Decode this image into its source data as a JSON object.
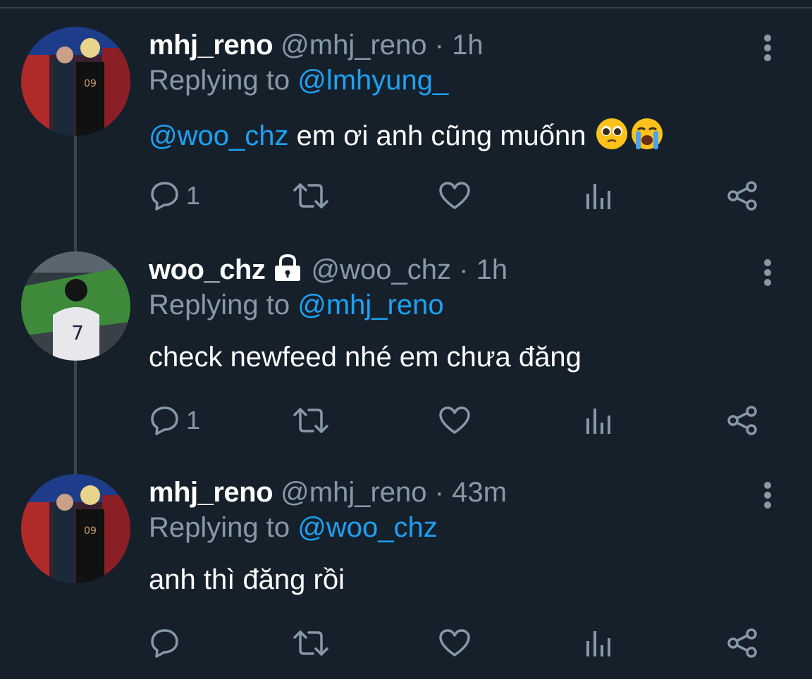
{
  "tweets": [
    {
      "display_name": "mhj_reno",
      "handle": "@mhj_reno",
      "time": "1h",
      "replying_label": "Replying to ",
      "replying_to": "@lmhyung_",
      "mention": "@woo_chz",
      "text": " em ơi anh cũng muốnn",
      "emojis": [
        "pleading-face",
        "loudly-crying-face"
      ],
      "reply_count": "1",
      "locked": false
    },
    {
      "display_name": "woo_chz",
      "handle": "@woo_chz",
      "time": "1h",
      "replying_label": "Replying to ",
      "replying_to": "@mhj_reno",
      "text": "check newfeed nhé em chưa đăng",
      "reply_count": "1",
      "locked": true
    },
    {
      "display_name": "mhj_reno",
      "handle": "@mhj_reno",
      "time": "43m",
      "replying_label": "Replying to ",
      "replying_to": "@woo_chz",
      "text": "anh thì đăng rồi",
      "reply_count": "",
      "locked": false
    }
  ],
  "separator": "·",
  "icons": [
    "reply-icon",
    "retweet-icon",
    "like-icon",
    "analytics-icon",
    "share-icon",
    "more-options-icon",
    "lock-icon"
  ],
  "colors": {
    "background": "#15202b",
    "muted": "#8899a6",
    "accent": "#1da1f2",
    "line": "#38444d"
  }
}
